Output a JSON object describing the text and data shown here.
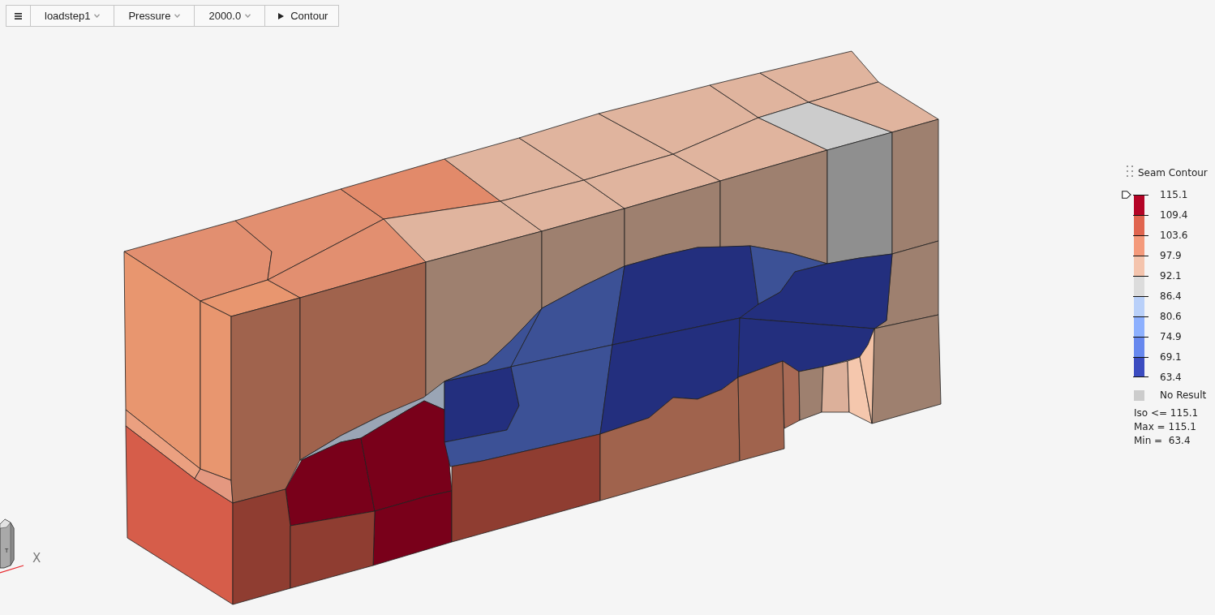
{
  "toolbar": [
    {
      "kind": "menu"
    },
    {
      "kind": "dropdown",
      "label": "loadstep1"
    },
    {
      "kind": "dropdown",
      "label": "Pressure"
    },
    {
      "kind": "dropdown",
      "label": "2000.0"
    },
    {
      "kind": "action",
      "label": "Contour"
    }
  ],
  "legend": {
    "title": "Seam Contour",
    "bands": [
      {
        "color": "#b40426"
      },
      {
        "color": "#e0654f"
      },
      {
        "color": "#f49a7b"
      },
      {
        "color": "#f4c4ad"
      },
      {
        "color": "#dcdcdc"
      },
      {
        "color": "#b9d0f9"
      },
      {
        "color": "#8db0fe"
      },
      {
        "color": "#6788ee"
      },
      {
        "color": "#3b4cc0"
      }
    ],
    "ticks": [
      "115.1",
      "109.4",
      "103.6",
      "97.9",
      "92.1",
      "86.4",
      "80.6",
      "74.9",
      "69.1",
      "63.4"
    ],
    "no_result": "No Result",
    "stats": [
      "Iso <= 115.1",
      "Max = 115.1",
      "Min =  63.4"
    ]
  },
  "triad": {
    "cube_label": "T",
    "axis_label": "X"
  }
}
